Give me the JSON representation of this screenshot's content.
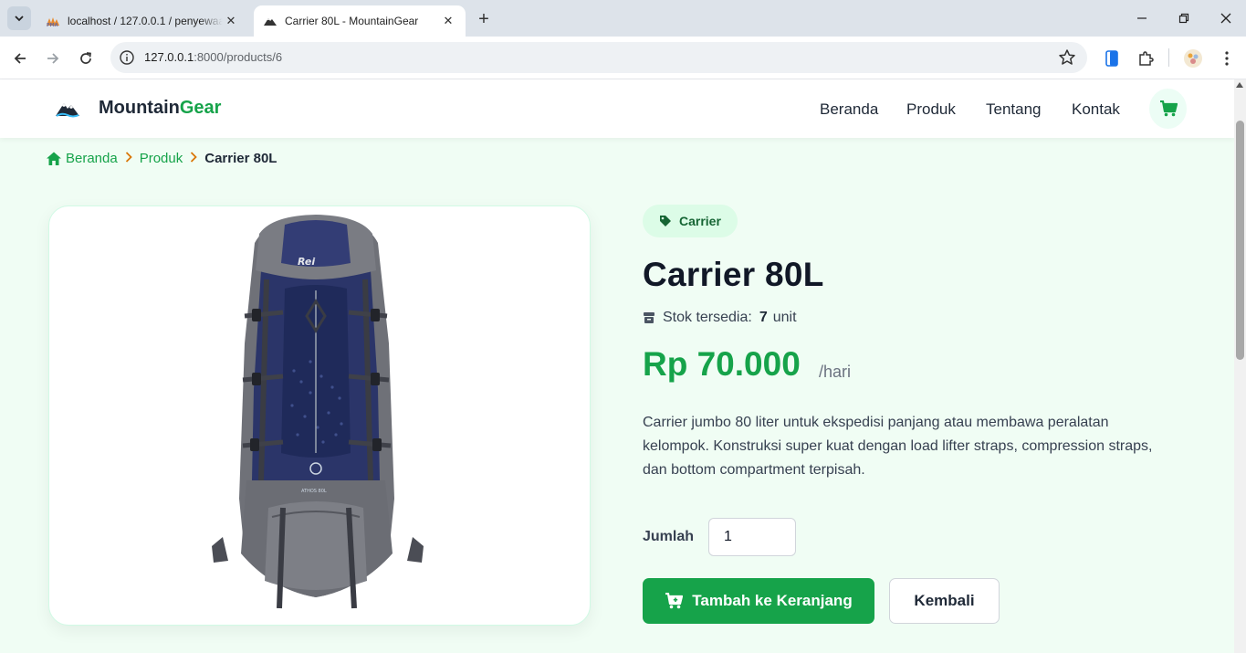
{
  "browser": {
    "tabs": [
      {
        "title": "localhost / 127.0.0.1 / penyewaan",
        "active": false
      },
      {
        "title": "Carrier 80L - MountainGear",
        "active": true
      }
    ],
    "url_host": "127.0.0.1",
    "url_path": ":8000/products/6"
  },
  "site": {
    "brand_main": "Mountain",
    "brand_accent": "Gear",
    "nav": [
      "Beranda",
      "Produk",
      "Tentang",
      "Kontak"
    ],
    "accent_color": "#16a34a"
  },
  "breadcrumb": {
    "home": "Beranda",
    "section": "Produk",
    "current": "Carrier 80L"
  },
  "product": {
    "category": "Carrier",
    "title": "Carrier 80L",
    "stock_label": "Stok tersedia:",
    "stock_value": "7",
    "stock_unit": "unit",
    "price": "Rp 70.000",
    "price_unit": "/hari",
    "description": "Carrier jumbo 80 liter untuk ekspedisi panjang atau membawa peralatan kelompok. Konstruksi super kuat dengan load lifter straps, compression straps, dan bottom compartment terpisah.",
    "quantity_label": "Jumlah",
    "quantity_value": "1",
    "add_to_cart_label": "Tambah ke Keranjang",
    "back_label": "Kembali"
  }
}
